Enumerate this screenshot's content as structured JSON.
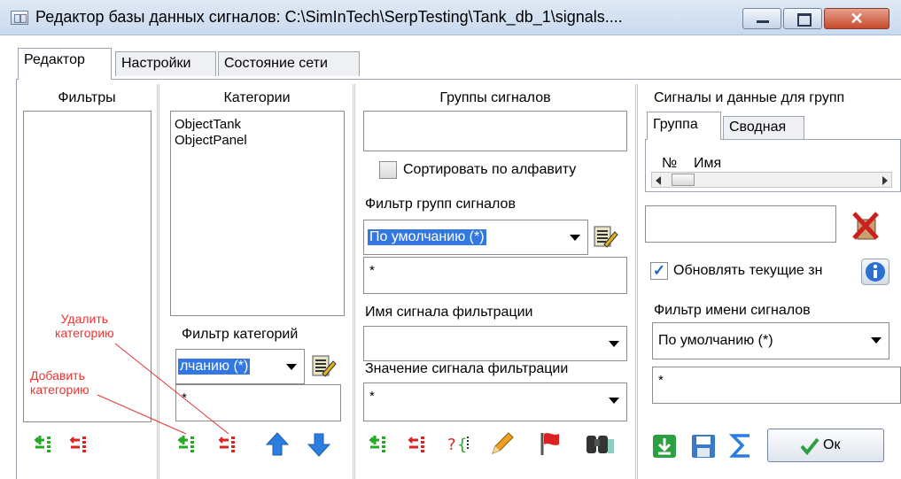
{
  "window": {
    "title": "Редактор базы данных сигналов: C:\\SimInTech\\SerpTesting\\Tank_db_1\\signals....",
    "close_label": "✕"
  },
  "tabs": [
    "Редактор",
    "Настройки",
    "Состояние сети"
  ],
  "filters": {
    "title": "Фильтры"
  },
  "categories": {
    "title": "Категории",
    "items": [
      "ObjectTank",
      "ObjectPanel"
    ],
    "filter_label": "Фильтр категорий",
    "filter_value": "лчанию (*)",
    "filter_text": "*"
  },
  "groups": {
    "title": "Группы сигналов",
    "sort_label": "Сортировать по алфавиту",
    "filter_label": "Фильтр групп сигналов",
    "filter_value": "По умолчанию (*)",
    "filter_text": "*",
    "signal_name_label": "Имя сигнала фильтрации",
    "signal_value_label": "Значение сигнала фильтрации",
    "signal_value_text": "*"
  },
  "signals": {
    "title": "Сигналы и данные для групп",
    "tabs": [
      "Группа",
      "Сводная"
    ],
    "columns": [
      "№",
      "Имя"
    ],
    "update_label": "Обновлять текущие зн",
    "update_checked": true,
    "name_filter_label": "Фильтр имени сигналов",
    "name_filter_value": "По умолчанию (*)",
    "name_filter_text": "*",
    "ok_label": "Ок"
  },
  "annotations": {
    "delete_category": [
      "Удалить",
      "категорию"
    ],
    "add_category": [
      "Добавить",
      "категорию"
    ]
  },
  "colors": {
    "selection": "#3378e0",
    "annotation": "#e33333",
    "add_icon": "#22aa22",
    "remove_icon": "#dd2222",
    "arrow_icon": "#2b7de0"
  }
}
